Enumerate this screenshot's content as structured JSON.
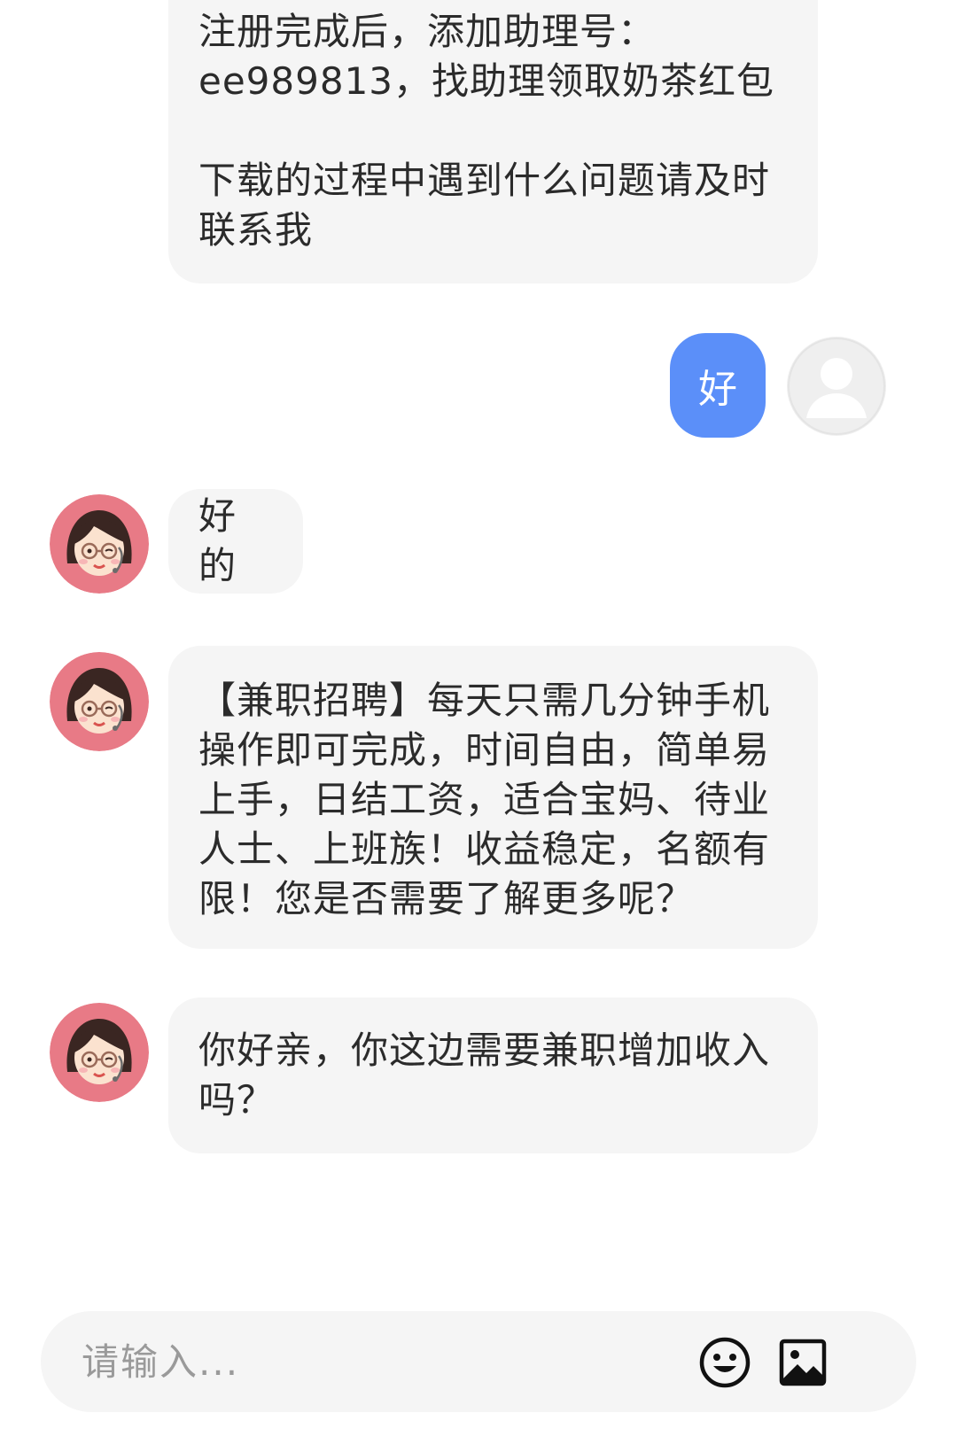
{
  "messages": {
    "m1": {
      "p1_line1": "注册完成后，添加助理号：",
      "p1_line2": "ee989813，找助理领取奶茶红包",
      "p2_line1": "下载的过程中遇到什么问题请及时",
      "p2_line2": "联系我"
    },
    "m2": {
      "text": "好"
    },
    "m3": {
      "text": "好的"
    },
    "m4": {
      "line1": "【兼职招聘】每天只需几分钟手机",
      "line2": "操作即可完成，时间自由，简单易",
      "line3": "上手，日结工资，适合宝妈、待业",
      "line4": "人士、上班族！收益稳定，名额有",
      "line5": "限！您是否需要了解更多呢？"
    },
    "m5": {
      "line1": "你好亲，你这边需要兼职增加收入",
      "line2": "吗？"
    }
  },
  "composer": {
    "placeholder": "请输入...",
    "emoji_icon": "emoji-icon",
    "image_icon": "image-icon"
  },
  "colors": {
    "bubble_in": "#f5f5f5",
    "bubble_out": "#5b8ff9",
    "avatar_bg": "#e87a86"
  }
}
